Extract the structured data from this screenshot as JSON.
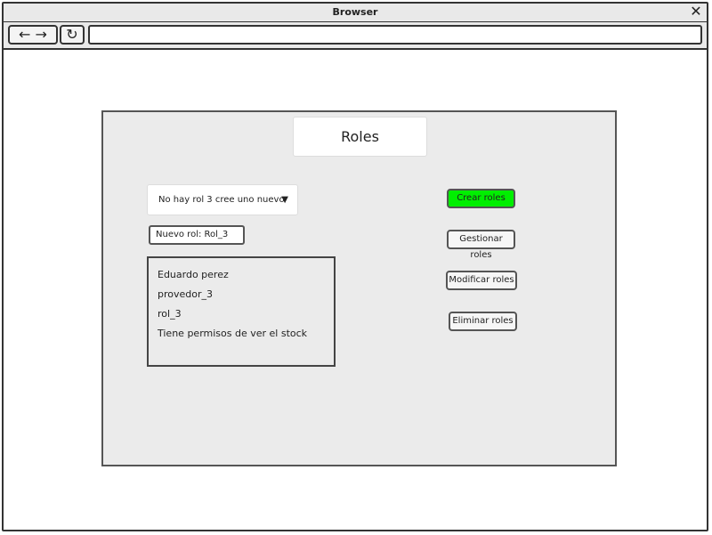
{
  "window": {
    "title": "Browser",
    "close_glyph": "✕"
  },
  "toolbar": {
    "back_forward_glyph": "← →",
    "reload_glyph": "↻",
    "address": ""
  },
  "roles_panel": {
    "title": "Roles",
    "dropdown": {
      "selected": "No hay rol 3 cree uno nuevo",
      "arrow": "▼"
    },
    "new_role_field": "Nuevo rol:  Rol_3",
    "list_items": [
      "Eduardo perez",
      "provedor_3",
      "rol_3",
      "Tiene permisos de ver el stock"
    ],
    "buttons": {
      "create": "Crear roles",
      "manage": "Gestionar roles",
      "modify": "Modificar roles",
      "delete": "Eliminar roles"
    },
    "colors": {
      "create_button": "#00ef00",
      "panel_bg": "#ebebeb"
    }
  }
}
